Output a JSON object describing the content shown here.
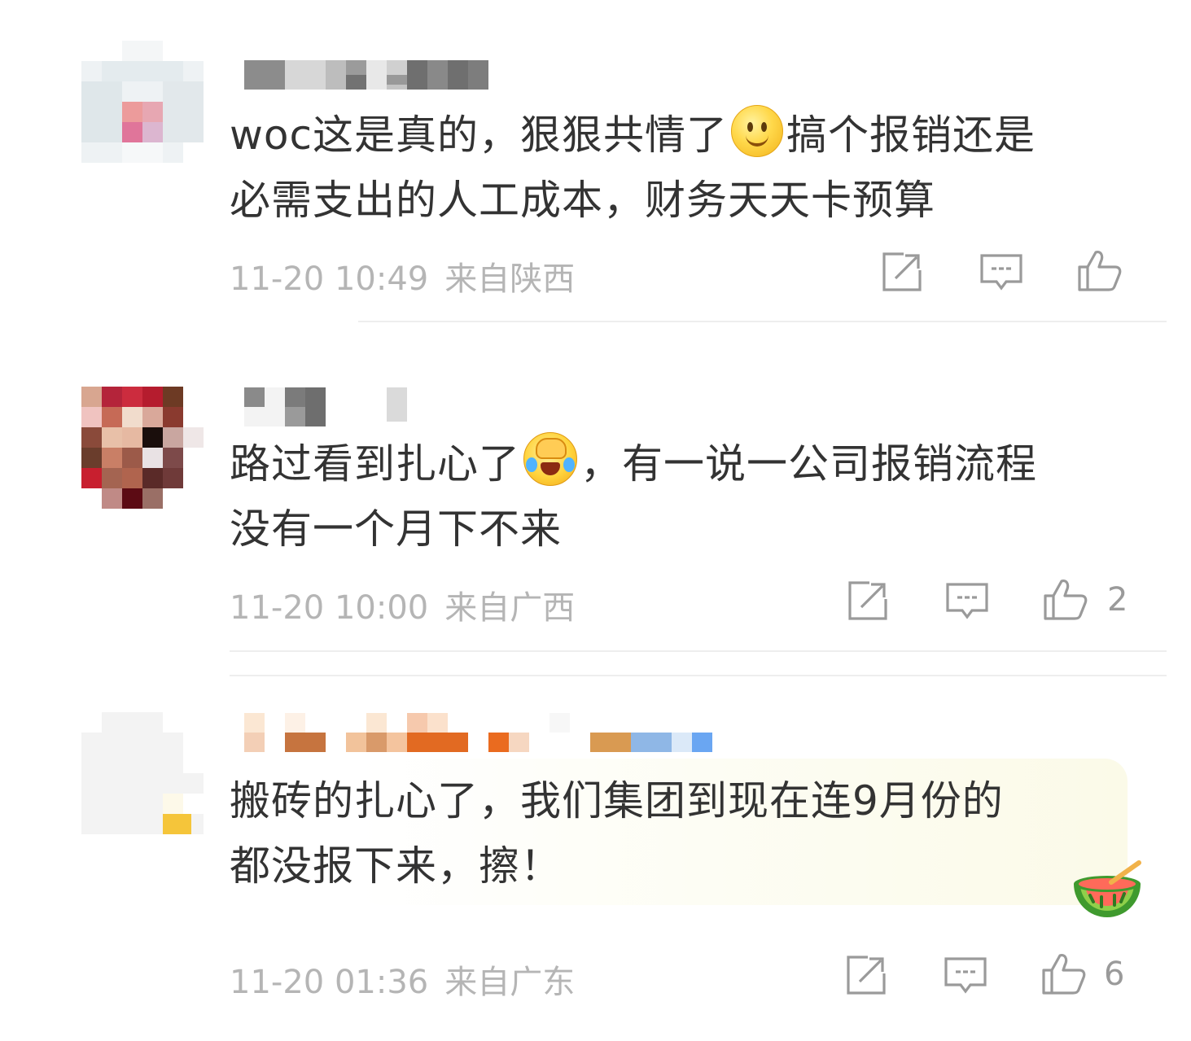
{
  "comments": [
    {
      "text_line1": "woc这是真的，狠狠共情了",
      "text_line1b": "搞个报销还是",
      "text_line2": "必需支出的人工成本，财务天天卡预算",
      "emoji": "smile-emoji",
      "time": "11-20 10:49",
      "location": "来自陕西",
      "like_count": ""
    },
    {
      "text_line1": "路过看到扎心了",
      "text_line1b": "，有一说一公司报销流程",
      "text_line2": "没有一个月下不来",
      "emoji": "laugh-cry-emoji",
      "time": "11-20 10:00",
      "location": "来自广西",
      "like_count": "2"
    },
    {
      "text_line1": "搬砖的扎心了，我们集团到现在连9月份的",
      "text_line2": "都没报下来，擦！",
      "badge": "watermelon-badge",
      "time": "11-20 01:36",
      "location": "来自广东",
      "like_count": "6"
    }
  ],
  "icons": {
    "repost": "repost-icon",
    "comment": "comment-icon",
    "like": "thumbs-up-icon"
  },
  "colors": {
    "text": "#333333",
    "meta": "#b5b5b5",
    "icon": "#9a9a9a",
    "divider": "#eeeeee"
  }
}
